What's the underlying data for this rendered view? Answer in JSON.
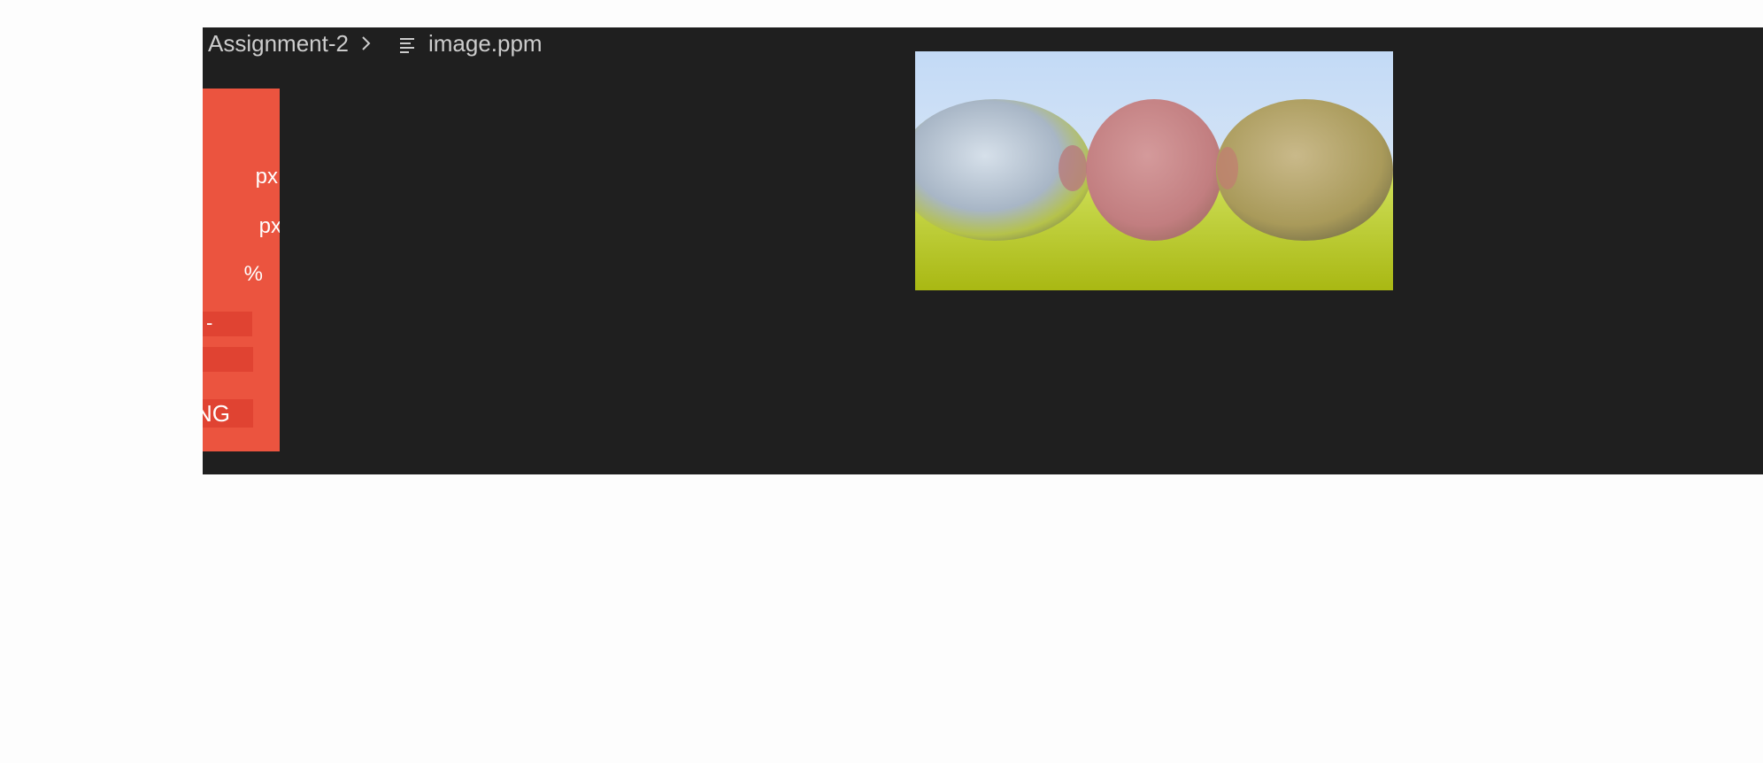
{
  "breadcrumb": {
    "items": [
      "Assignment-2",
      "image.ppm"
    ],
    "file_icon": "lines-file-icon",
    "separator_icon": "chevron-right-icon"
  },
  "side_panel": {
    "lines": [
      "px",
      "px",
      "%"
    ],
    "rows": [
      "-",
      "",
      "NG"
    ],
    "accent_color": "#eb543f"
  },
  "preview": {
    "image_name": "image.ppm",
    "sky_color": "#c8dcf2",
    "ground_color": "#b8c91e",
    "sphere_colors": [
      "#b8c4d2",
      "#c98887",
      "#b8a968"
    ]
  }
}
